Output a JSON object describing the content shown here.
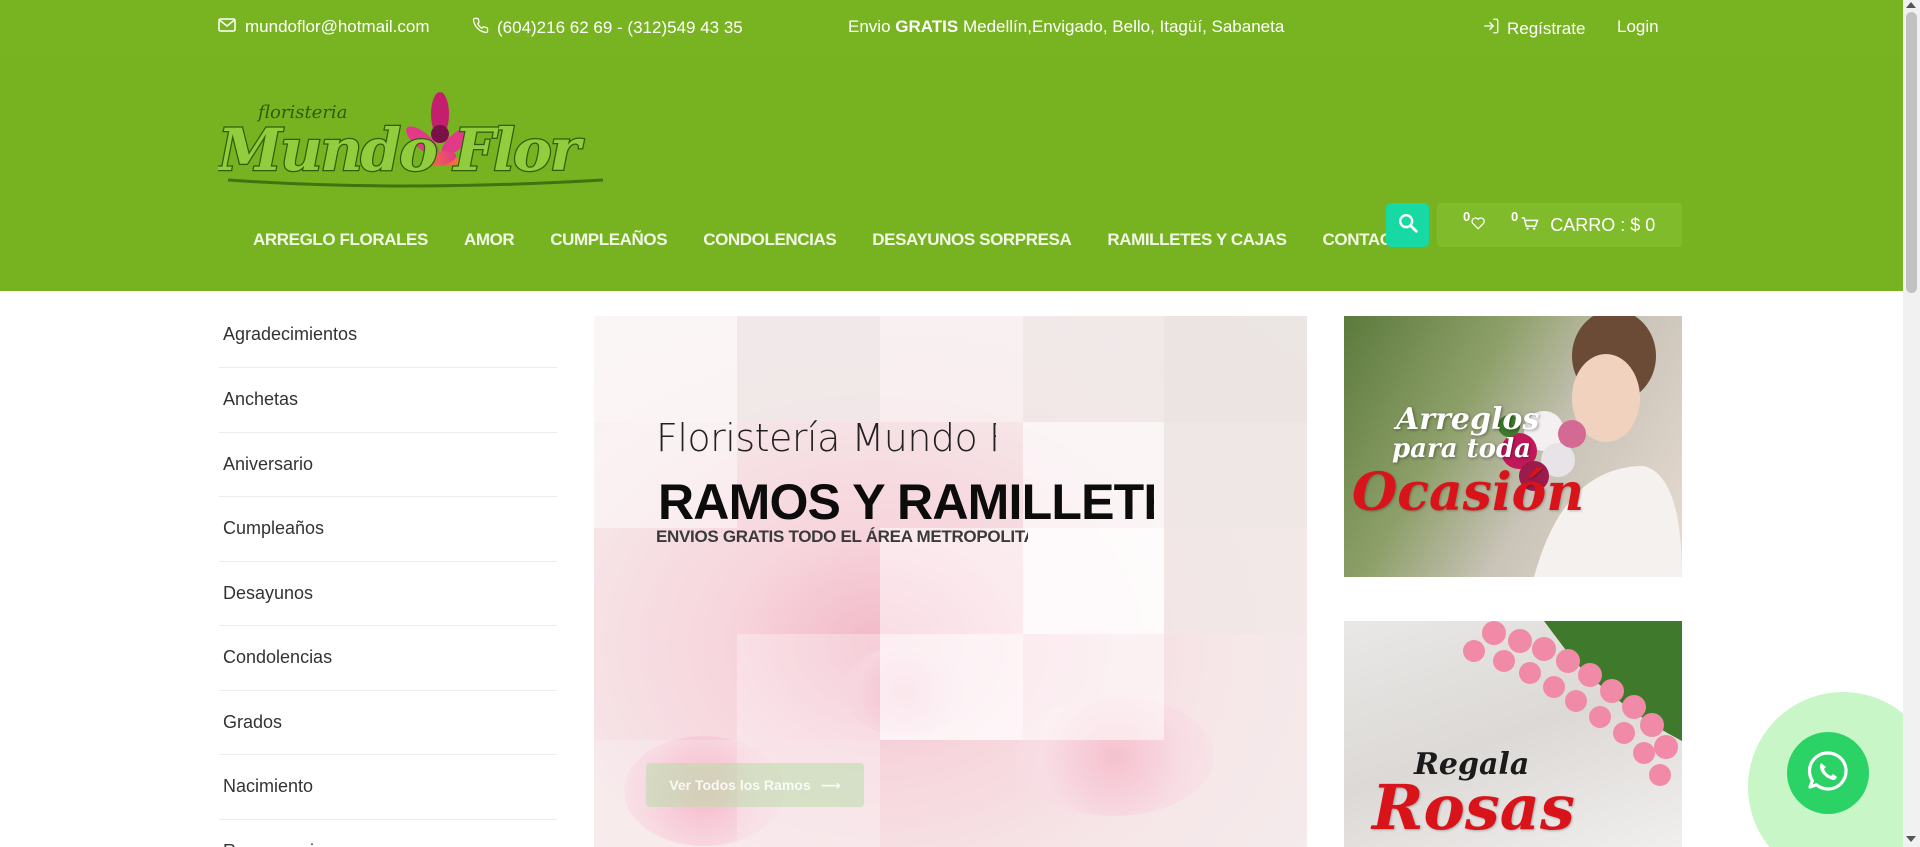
{
  "topbar": {
    "email": "mundoflor@hotmail.com",
    "phone": "(604)216 62 69 - (312)549 43 35",
    "envio_prefix": "Envio",
    "envio_bold": "GRATIS",
    "envio_places": "Medellín,Envigado, Bello, Itagüí, Sabaneta",
    "register": "Regístrate",
    "login": "Login"
  },
  "header": {
    "logo": {
      "small_text": "floristeria",
      "big_text": "Mundo Flor"
    },
    "nav": [
      "ARREGLO FLORALES",
      "AMOR",
      "CUMPLEAÑOS",
      "CONDOLENCIAS",
      "DESAYUNOS SORPRESA",
      "RAMILLETES Y CAJAS",
      "CONTACTO"
    ],
    "wishlist_count": "0",
    "cart_count": "0",
    "cart_label": "CARRO : $ 0"
  },
  "sidebar": {
    "items": [
      "Agradecimientos",
      "Anchetas",
      "Aniversario",
      "Cumpleaños",
      "Desayunos",
      "Condolencias",
      "Grados",
      "Nacimiento",
      "Recuperacion"
    ]
  },
  "slider": {
    "subtitle": "Floristería Mundo Flor",
    "title": "RAMOS Y RAMILLETES",
    "tagline": "ENVIOS GRATIS TODO EL ÁREA METROPOLITANA",
    "button": "Ver Todos los Ramos",
    "button_arrow": "⟶"
  },
  "banners": [
    {
      "line1": "Arreglos",
      "line2": "para toda",
      "big": "Ocasión"
    },
    {
      "line1": "Regala",
      "big": "Rosas"
    }
  ],
  "colors": {
    "topbar": "#78b422",
    "header": "#77b321",
    "search_button": "#17d9a3",
    "whatsapp": "#2bd366",
    "banner_red": "#d8141a"
  },
  "icons": {
    "email": "envelope-icon",
    "phone": "phone-icon",
    "register": "login-door-icon",
    "search": "search-icon",
    "wishlist": "heart-icon",
    "cart": "cart-icon",
    "whatsapp": "whatsapp-icon"
  }
}
